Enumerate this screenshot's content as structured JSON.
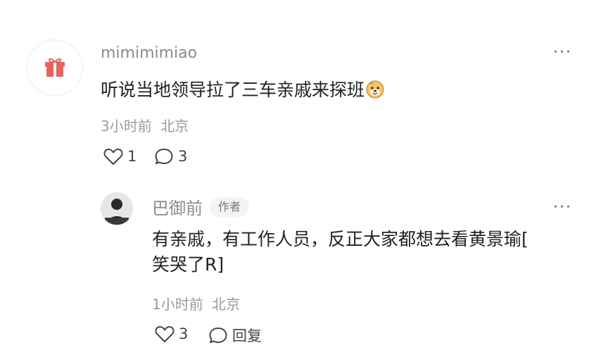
{
  "comment": {
    "username": "mimimimiao",
    "text": "听说当地领导拉了三车亲戚来探班",
    "time": "3小时前",
    "location": "北京",
    "likes": "1",
    "replies": "3"
  },
  "reply": {
    "username": "巴御前",
    "badge": "作者",
    "text_line1": "有亲戚，有工作人员，反正大家都想去看黄景瑜[",
    "text_line2": "笑哭了R]",
    "time": "1小时前",
    "location": "北京",
    "likes": "3",
    "reply_label": "回复"
  },
  "icons": {
    "gift": "gift-icon",
    "more": "more-icon",
    "heart": "heart-icon",
    "comment": "comment-icon"
  },
  "colors": {
    "gift": "#e8635a",
    "text_primary": "#222222",
    "text_secondary": "#9a9a9a"
  }
}
